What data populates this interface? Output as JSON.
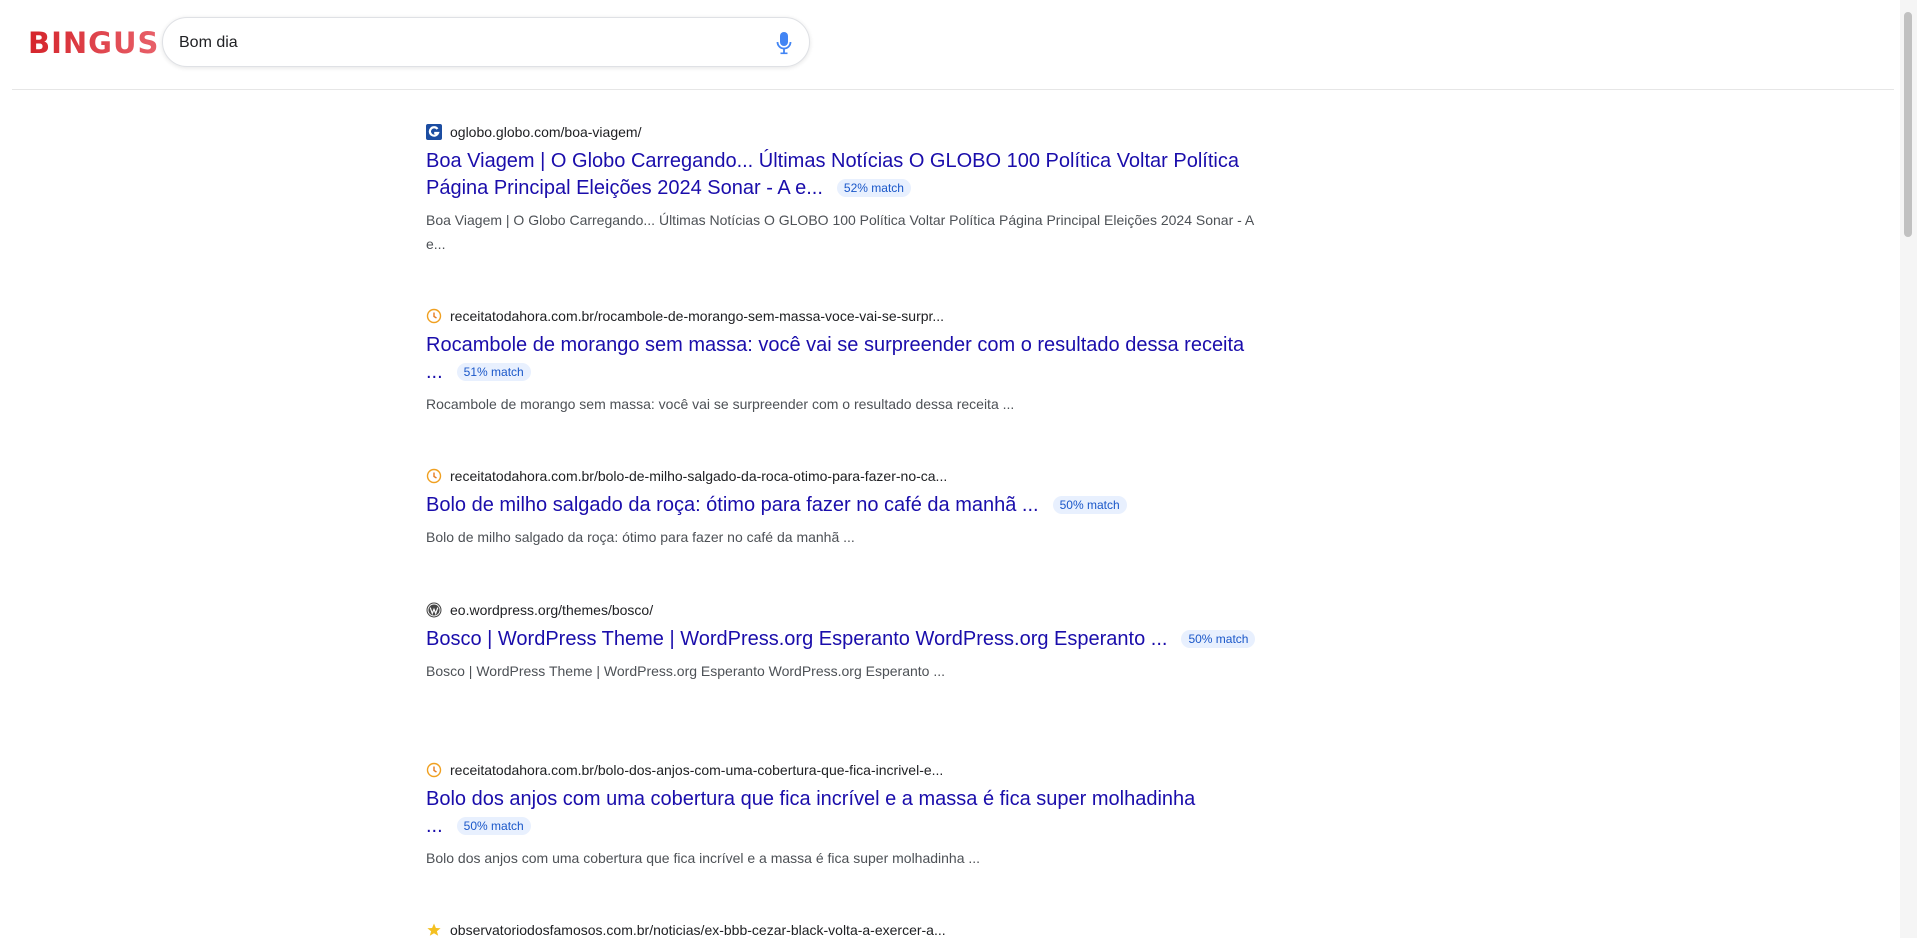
{
  "app": {
    "logo": "BINGUS"
  },
  "search": {
    "query": "Bom dia"
  },
  "results": [
    {
      "url": "oglobo.globo.com/boa-viagem/",
      "favicon": "globo-g-icon",
      "title": "Boa Viagem | O Globo Carregando... Últimas Notícias O GLOBO 100 Política Voltar Política Página Principal Eleições 2024 Sonar - A e...",
      "match": "52% match",
      "snippet": "Boa Viagem | O Globo Carregando... Últimas Notícias O GLOBO 100 Política Voltar Política Página Principal Eleições 2024 Sonar - A e..."
    },
    {
      "url": "receitatodahora.com.br/rocambole-de-morango-sem-massa-voce-vai-se-surpr...",
      "favicon": "clock-icon",
      "title": "Rocambole de morango sem massa: você vai se surpreender com o resultado dessa receita ...",
      "match": "51% match",
      "snippet": "Rocambole de morango sem massa: você vai se surpreender com o resultado dessa receita ..."
    },
    {
      "url": "receitatodahora.com.br/bolo-de-milho-salgado-da-roca-otimo-para-fazer-no-ca...",
      "favicon": "clock-icon",
      "title": "Bolo de milho salgado da roça: ótimo para fazer no café da manhã ...",
      "match": "50% match",
      "snippet": "Bolo de milho salgado da roça: ótimo para fazer no café da manhã ..."
    },
    {
      "url": "eo.wordpress.org/themes/bosco/",
      "favicon": "wordpress-icon",
      "title": "Bosco | WordPress Theme | WordPress.org Esperanto WordPress.org Esperanto ...",
      "match": "50% match",
      "snippet": "Bosco | WordPress Theme | WordPress.org Esperanto WordPress.org Esperanto ..."
    },
    {
      "url": "receitatodahora.com.br/bolo-dos-anjos-com-uma-cobertura-que-fica-incrivel-e...",
      "favicon": "clock-icon",
      "title": "Bolo dos anjos com uma cobertura que fica incrível e a massa é fica super molhadinha ...",
      "match": "50% match",
      "snippet": "Bolo dos anjos com uma cobertura que fica incrível e a massa é fica super molhadinha ..."
    },
    {
      "url": "observatoriodosfamosos.com.br/noticias/ex-bbb-cezar-black-volta-a-exercer-a...",
      "favicon": "star-icon",
      "title": "",
      "match": "",
      "snippet": ""
    }
  ],
  "colors": {
    "link": "#1a0dab",
    "badge_bg": "#e8f0fe",
    "badge_text": "#1a57c9",
    "logo": "#d5242b"
  }
}
